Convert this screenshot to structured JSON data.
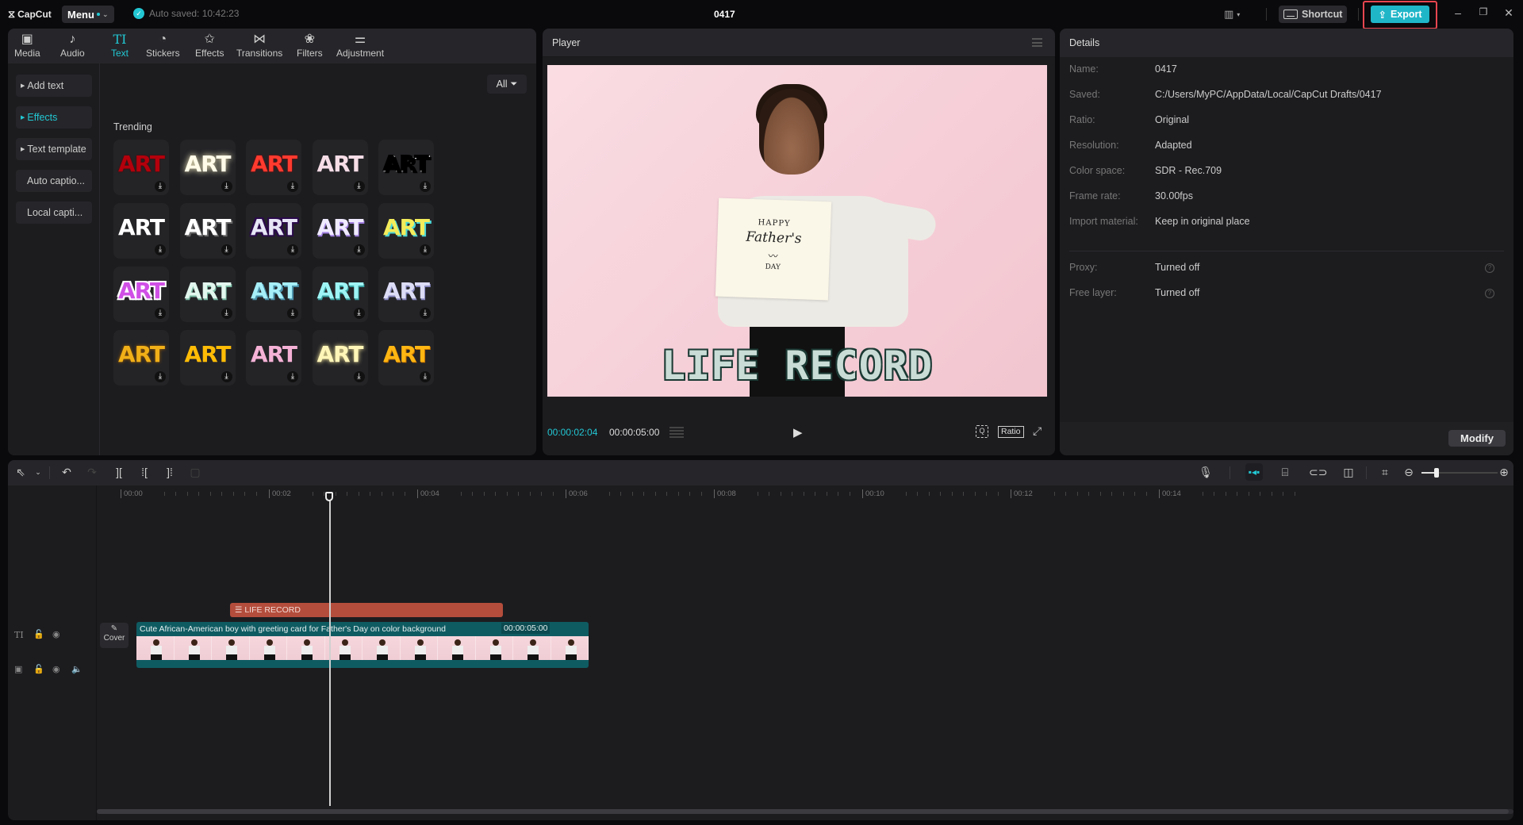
{
  "titlebar": {
    "app_name": "CapCut",
    "menu_label": "Menu",
    "autosave_text": "Auto saved: 10:42:23",
    "project_title": "0417",
    "shortcut_label": "Shortcut",
    "export_label": "Export",
    "export_highlighted": true
  },
  "left_panel": {
    "tabs": [
      {
        "label": "Media",
        "icon": "media-icon",
        "glyph": "▣"
      },
      {
        "label": "Audio",
        "icon": "audio-icon",
        "glyph": "♪"
      },
      {
        "label": "Text",
        "icon": "text-icon",
        "glyph": "TI",
        "active": true
      },
      {
        "label": "Stickers",
        "icon": "sticker-icon",
        "glyph": "◔"
      },
      {
        "label": "Effects",
        "icon": "effects-icon",
        "glyph": "✩"
      },
      {
        "label": "Transitions",
        "icon": "transitions-icon",
        "glyph": "⋈"
      },
      {
        "label": "Filters",
        "icon": "filters-icon",
        "glyph": "❀"
      },
      {
        "label": "Adjustment",
        "icon": "adjustment-icon",
        "glyph": "⚌"
      }
    ],
    "side_nav": [
      {
        "label": "Add text",
        "arrow": true,
        "active": false
      },
      {
        "label": "Effects",
        "arrow": true,
        "active": true
      },
      {
        "label": "Text template",
        "arrow": true,
        "active": false
      },
      {
        "label": "Auto captio...",
        "arrow": false,
        "active": false
      },
      {
        "label": "Local capti...",
        "arrow": false,
        "active": false
      }
    ],
    "filter_label": "All",
    "section_title": "Trending",
    "presets": [
      [
        {
          "text": "ART",
          "color": "#b3000c",
          "style": "dark-red"
        },
        {
          "text": "ART",
          "color": "#fffbe8",
          "style": "glow-white"
        },
        {
          "text": "ART",
          "color": "#ff3a2e",
          "style": "red"
        },
        {
          "text": "ART",
          "color": "#f6dde6",
          "style": "pink-white"
        },
        {
          "text": "ART",
          "color": "#f0f0f0",
          "style": "black-outline"
        }
      ],
      [
        {
          "text": "ART",
          "color": "#ffffff",
          "style": "white"
        },
        {
          "text": "ART",
          "color": "#ffffff",
          "style": "white-shadow"
        },
        {
          "text": "ART",
          "color": "#e6e6f6",
          "style": "purple-outline"
        },
        {
          "text": "ART",
          "color": "#f0eaff",
          "style": "lavender"
        },
        {
          "text": "ART",
          "color": "#f4ec5a",
          "style": "yellow-cyan"
        }
      ],
      [
        {
          "text": "ART",
          "color": "#d050e6",
          "style": "magenta-white-outline"
        },
        {
          "text": "ART",
          "color": "#e2f7ee",
          "style": "mint"
        },
        {
          "text": "ART",
          "color": "#a6eef8",
          "style": "sky"
        },
        {
          "text": "ART",
          "color": "#9ef4f4",
          "style": "cyan"
        },
        {
          "text": "ART",
          "color": "#dcdcf6",
          "style": "periwinkle"
        }
      ],
      [
        {
          "text": "ART",
          "color": "#f2b018",
          "style": "gold"
        },
        {
          "text": "ART",
          "color": "#ffbc06",
          "style": "amber"
        },
        {
          "text": "ART",
          "color": "#f6b2d6",
          "style": "pink"
        },
        {
          "text": "ART",
          "color": "#fff6b8",
          "style": "pale-yellow-glow"
        },
        {
          "text": "ART",
          "color": "#ffb612",
          "style": "orange"
        }
      ]
    ]
  },
  "player": {
    "title": "Player",
    "overlay_text": "LIFE RECORD",
    "card_lines": [
      "HAPPY",
      "Father's",
      "DAY"
    ],
    "current_time": "00:00:02:04",
    "total_time": "00:00:05:00",
    "ratio_label": "Ratio"
  },
  "details": {
    "title": "Details",
    "rows": [
      {
        "label": "Name:",
        "value": "0417"
      },
      {
        "label": "Saved:",
        "value": "C:/Users/MyPC/AppData/Local/CapCut Drafts/0417"
      },
      {
        "label": "Ratio:",
        "value": "Original"
      },
      {
        "label": "Resolution:",
        "value": "Adapted"
      },
      {
        "label": "Color space:",
        "value": "SDR - Rec.709"
      },
      {
        "label": "Frame rate:",
        "value": "30.00fps"
      },
      {
        "label": "Import material:",
        "value": "Keep in original place"
      }
    ],
    "extra_rows": [
      {
        "label": "Proxy:",
        "value": "Turned off"
      },
      {
        "label": "Free layer:",
        "value": "Turned off"
      }
    ],
    "modify_label": "Modify"
  },
  "timeline": {
    "ruler_labels": [
      "00:00",
      "00:02",
      "00:04",
      "00:06",
      "00:08",
      "00:10",
      "00:12",
      "00:14"
    ],
    "playhead_time": "00:02",
    "text_clip_label": "LIFE RECORD",
    "video_clip_title": "Cute African-American boy with greeting card for Father's Day on color background",
    "video_clip_duration": "00:00:05:00",
    "cover_label": "Cover",
    "zoom_level": 0.2
  },
  "colors": {
    "accent": "#22c7d3",
    "export": "#1fb6c8",
    "annotation_red": "#e8464f",
    "text_clip": "#b44d3c",
    "video_clip": "#0f5b62"
  }
}
